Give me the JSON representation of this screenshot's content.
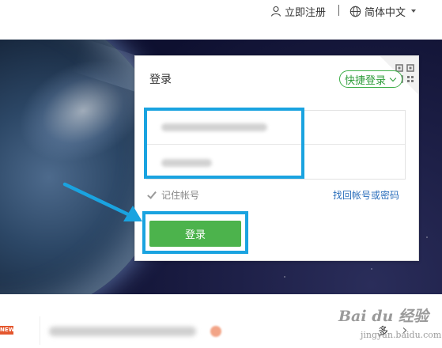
{
  "header": {
    "register_label": "立即注册",
    "separator": "|",
    "language_label": "简体中文"
  },
  "login_card": {
    "title": "登录",
    "quick_login_label": "快捷登录",
    "remember_label": "记住帐号",
    "find_account_label": "找回帐号或密码",
    "login_button_label": "登录"
  },
  "footer": {
    "new_badge": "NEW",
    "more_label": "多",
    "next_icon": "chevron-right-icon"
  },
  "watermark": {
    "text": "Bai du 经验",
    "sub": "jingyan.baidu.com"
  },
  "colors": {
    "accent_green": "#4cb34c",
    "highlight_blue": "#1aa3e0",
    "link_blue": "#2a6ebb"
  }
}
